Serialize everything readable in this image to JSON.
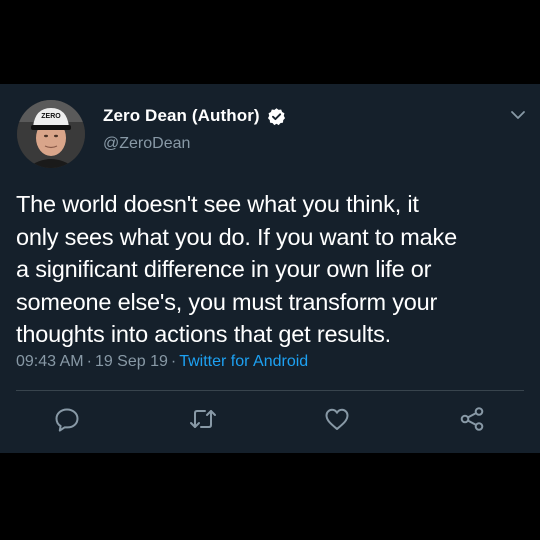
{
  "tweet": {
    "author": {
      "display_name": "Zero Dean (Author)",
      "handle": "@ZeroDean",
      "verified_icon": "verified-badge-icon",
      "cap_text": "ZERO"
    },
    "text_lines": [
      "The world doesn't see what you think, it",
      "only sees what you do. If you want to make",
      "a significant difference in your own life or",
      "someone else's, you must transform your",
      "thoughts into actions that get results."
    ],
    "time": "09:43 AM",
    "date": "19 Sep 19",
    "separator": "·",
    "source": "Twitter for Android"
  },
  "actions": [
    {
      "name": "reply",
      "icon": "reply-icon"
    },
    {
      "name": "retweet",
      "icon": "retweet-icon"
    },
    {
      "name": "like",
      "icon": "heart-icon"
    },
    {
      "name": "share",
      "icon": "share-icon"
    }
  ],
  "colors": {
    "background": "#15202b",
    "outer": "#000000",
    "primary_text": "#ffffff",
    "secondary_text": "#8899a6",
    "link": "#1da1f2",
    "divider": "#38444d"
  }
}
